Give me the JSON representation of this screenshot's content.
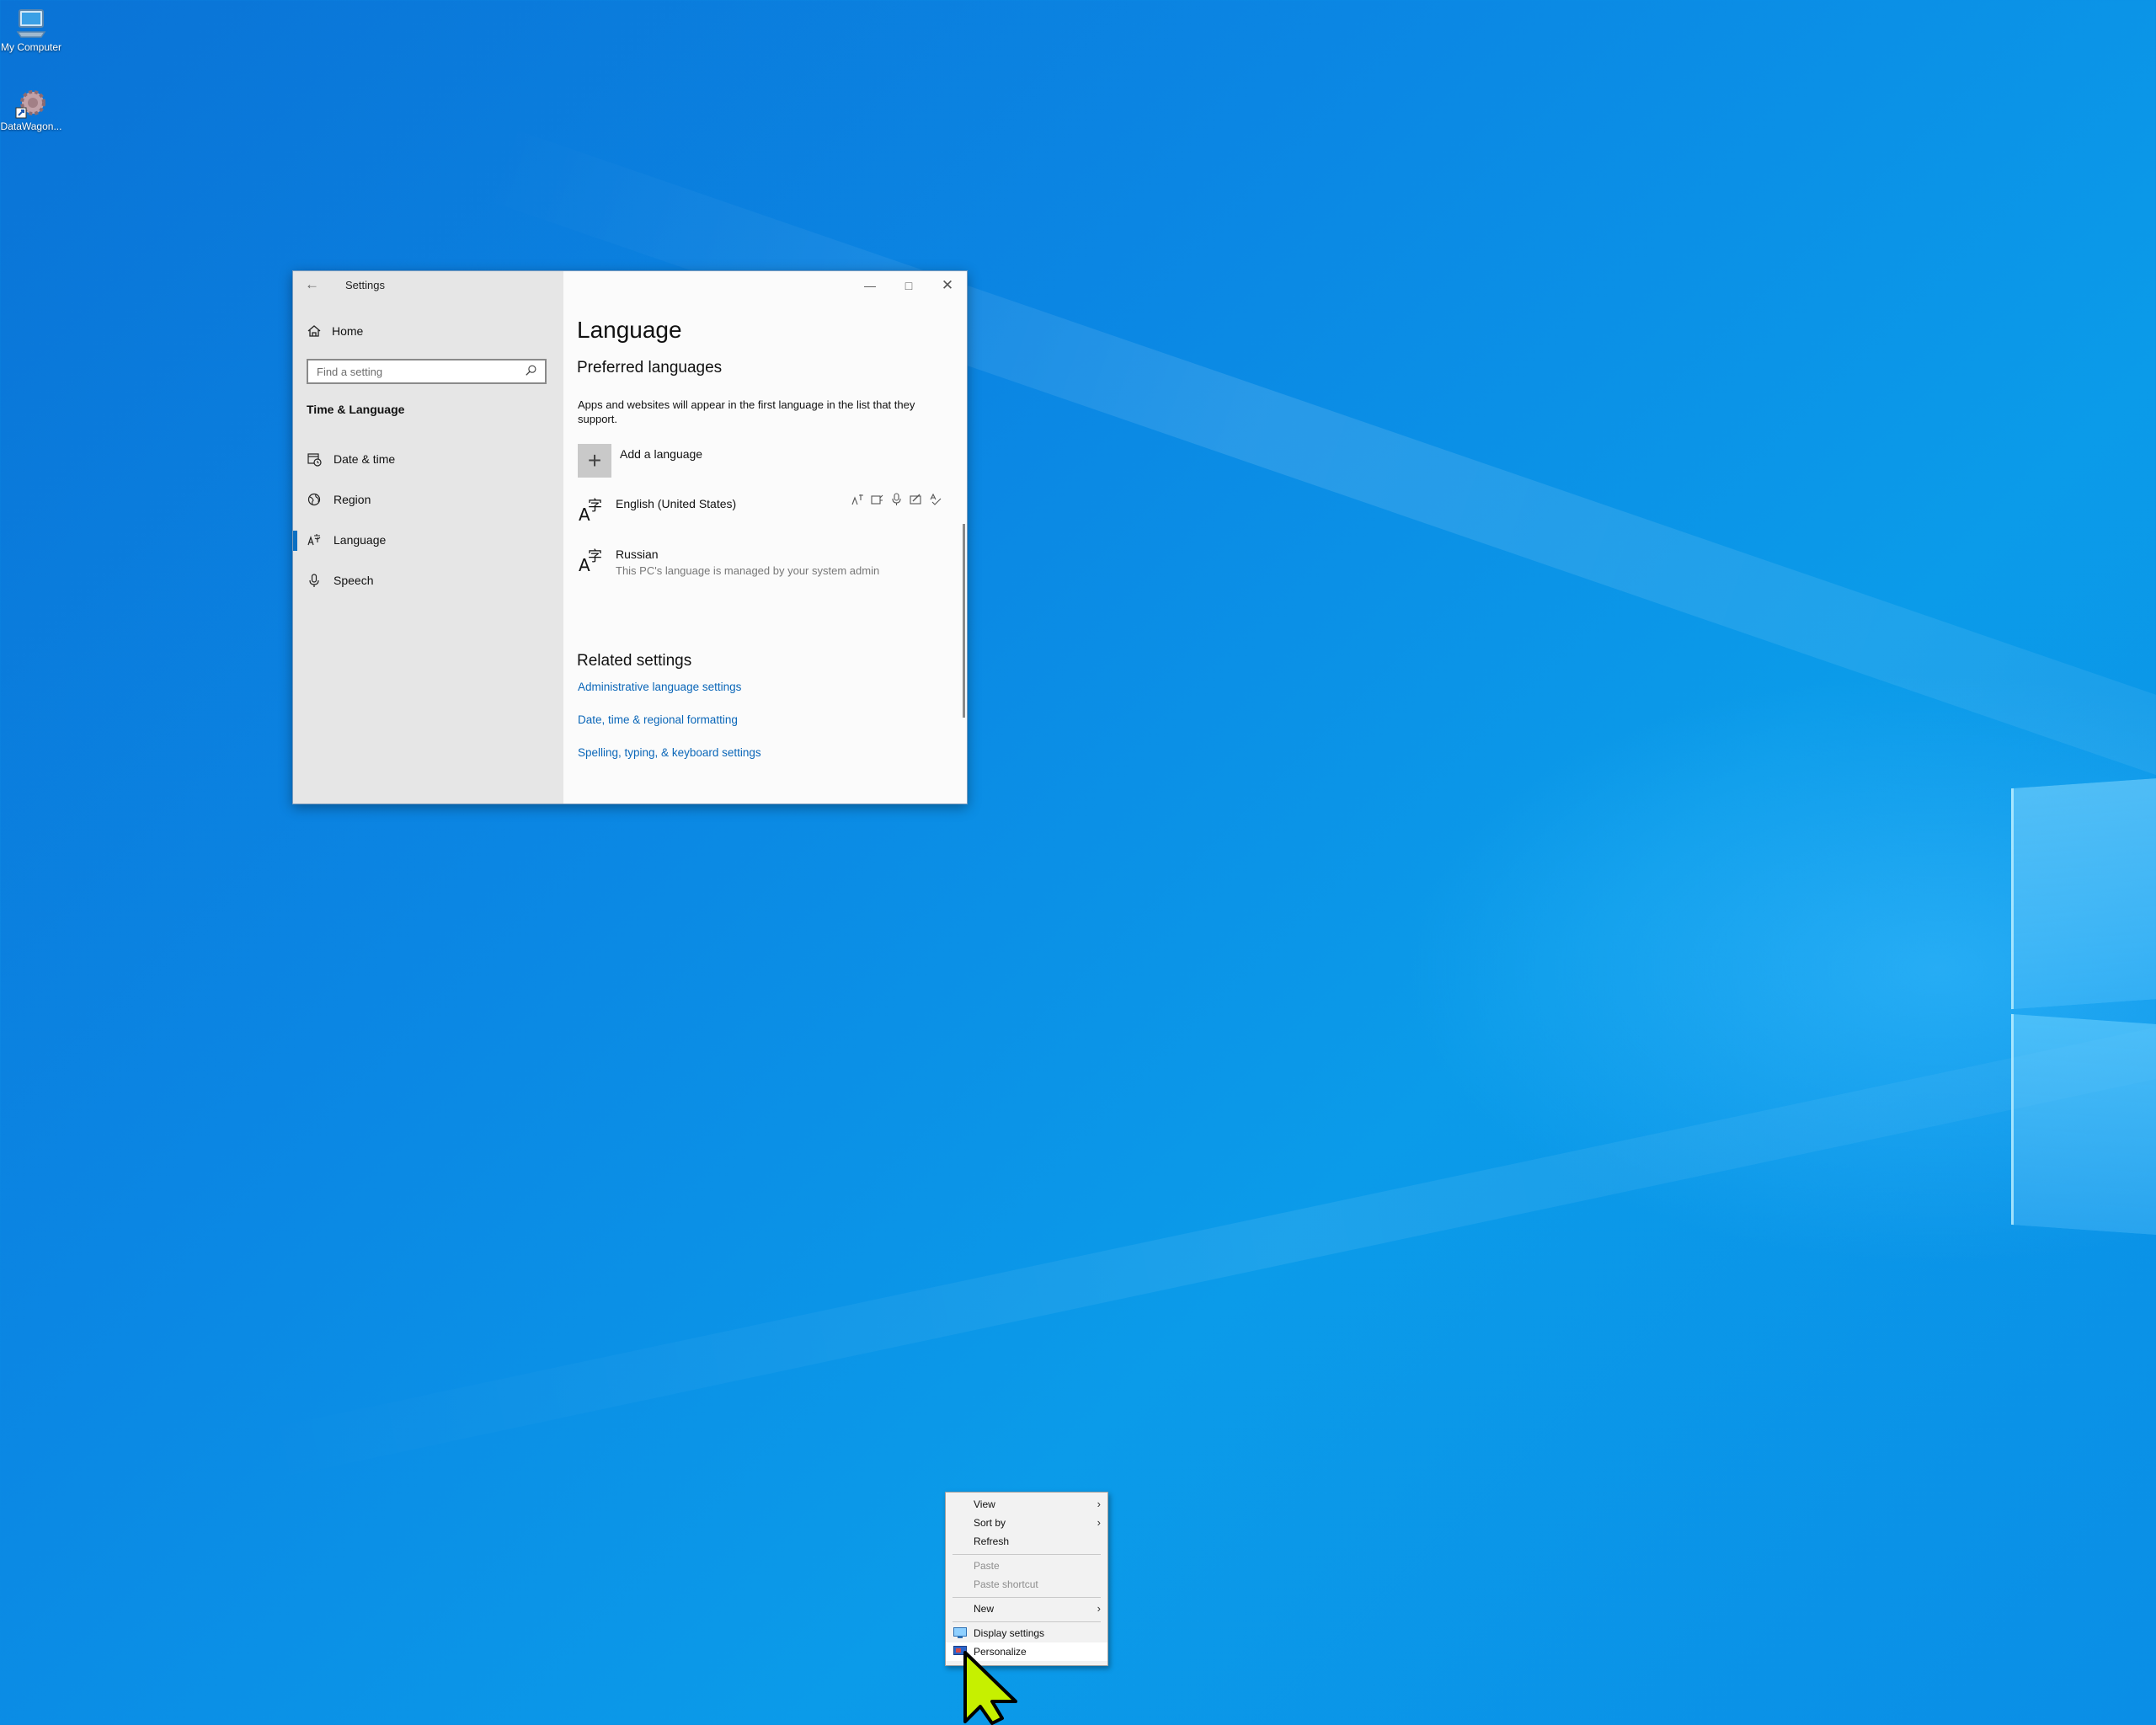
{
  "desktop": {
    "icons": [
      {
        "label": "My Computer"
      },
      {
        "label": "DataWagon..."
      }
    ]
  },
  "settings": {
    "title": "Settings",
    "sidebar": {
      "home": "Home",
      "search_placeholder": "Find a setting",
      "category": "Time & Language",
      "items": [
        {
          "label": "Date & time"
        },
        {
          "label": "Region"
        },
        {
          "label": "Language",
          "active": true
        },
        {
          "label": "Speech"
        }
      ]
    },
    "content": {
      "title": "Language",
      "preferred_heading": "Preferred languages",
      "description": "Apps and websites will appear in the first language in the list that they support.",
      "add_language": "Add a language",
      "languages": [
        {
          "name": "English (United States)",
          "note": ""
        },
        {
          "name": "Russian",
          "note": "This PC's language is managed by your system admin"
        }
      ],
      "related_heading": "Related settings",
      "links": [
        "Administrative language settings",
        "Date, time & regional formatting",
        "Spelling, typing, & keyboard settings"
      ]
    }
  },
  "context_menu": {
    "items": [
      {
        "label": "View",
        "submenu": true,
        "disabled": false
      },
      {
        "label": "Sort by",
        "submenu": true,
        "disabled": false
      },
      {
        "label": "Refresh",
        "submenu": false,
        "disabled": false
      },
      {
        "label": "Paste",
        "submenu": false,
        "disabled": true
      },
      {
        "label": "Paste shortcut",
        "submenu": false,
        "disabled": true
      },
      {
        "label": "New",
        "submenu": true,
        "disabled": false
      },
      {
        "label": "Display settings",
        "submenu": false,
        "disabled": false,
        "icon": "display-icon"
      },
      {
        "label": "Personalize",
        "submenu": false,
        "disabled": false,
        "icon": "personalize-icon",
        "highlighted": true
      }
    ]
  },
  "colors": {
    "accent": "#0a6fc2",
    "link": "#0a66b8",
    "cursor": "#c6f000"
  }
}
